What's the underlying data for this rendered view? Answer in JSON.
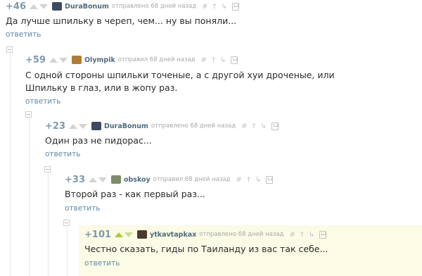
{
  "comments": [
    {
      "rating": "+46",
      "author": "DuraBonum",
      "meta": "отправлено 68 дней назад",
      "text": "Да лучше шпильку в череп, чем... ну вы поняли...",
      "reply": "ответить",
      "avatar_color": "#3d4a63"
    },
    {
      "rating": "+59",
      "author": "Olympik",
      "meta": "отправил 68 дней назад",
      "text_line1": "С одной стороны шпильки точеные, а с другой хуи дроченые, или",
      "text_line2": "Шпильку в глаз, или в жопу раз.",
      "reply": "ответить",
      "avatar_color": "#b07b3a"
    },
    {
      "rating": "+23",
      "author": "DuraBonum",
      "meta": "отправлено 68 дней назад",
      "text": "Один раз не пидорас...",
      "reply": "ответить",
      "avatar_color": "#3d4a63"
    },
    {
      "rating": "+33",
      "author": "obskoy",
      "meta": "отправил 68 дней назад",
      "text": "Второй раз - как первый раз...",
      "reply": "ответить",
      "avatar_color": "#7d8b6a"
    },
    {
      "rating": "+101",
      "author": "ytkavtapkax",
      "meta": "отправлено 68 дней назад",
      "text": "Честно сказать, гиды по Таиланду из вас так себе...",
      "reply": "ответить",
      "avatar_color": "#4a3b2e"
    }
  ],
  "tools": {
    "hash": "#",
    "pin": "†",
    "link": "↳"
  },
  "colors": {
    "rating": "#7f9aab",
    "author": "#4f6b7e",
    "reply_link": "#5f8aa8",
    "vote_up_active": "#a6cf3c",
    "highlight_bg": "#fbfbe6"
  }
}
